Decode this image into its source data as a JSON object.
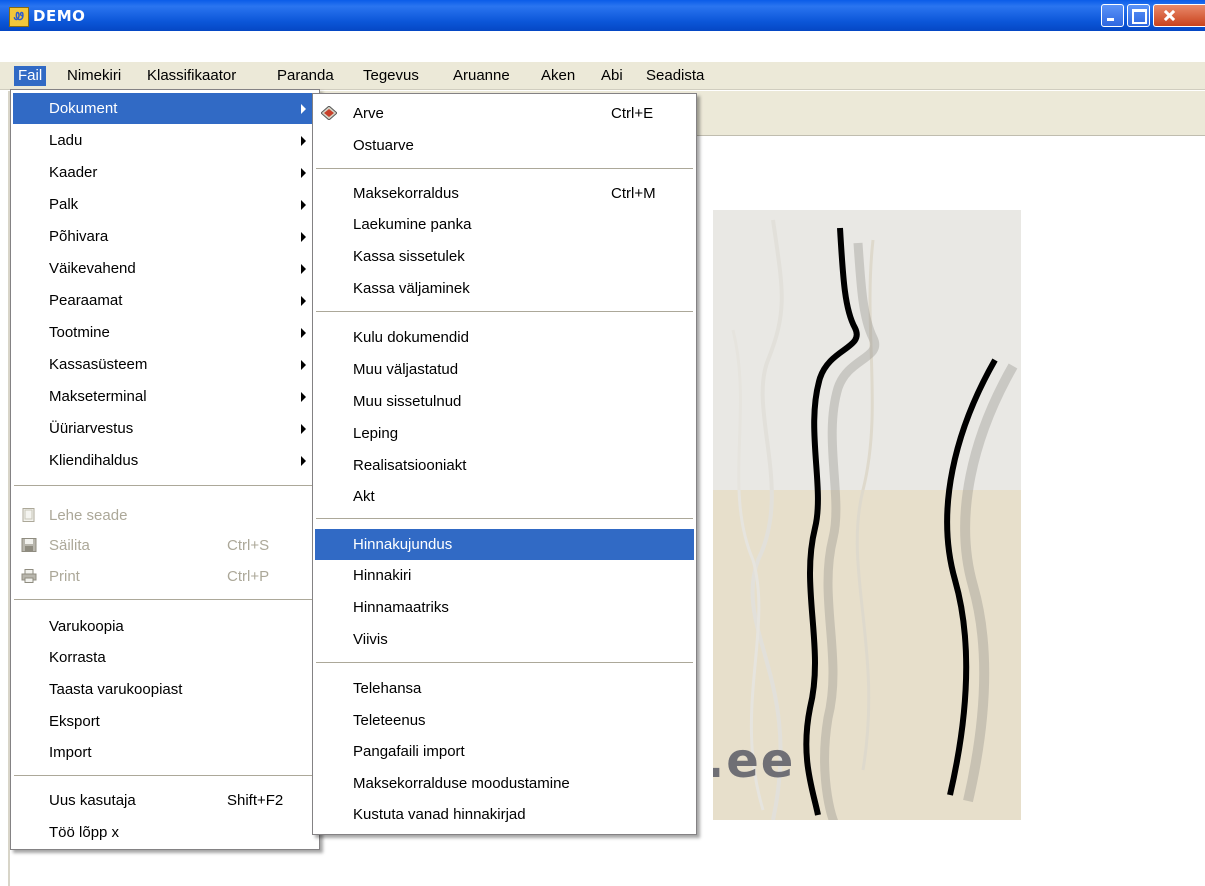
{
  "window": {
    "title": "DEMO",
    "app_icon_glyph": "Ꮺ"
  },
  "menubar": [
    "Fail",
    "Nimekiri",
    "Klassifikaator",
    "Paranda",
    "Tegevus",
    "Aruanne",
    "Aken",
    "Abi",
    "Seadista"
  ],
  "splash_text": ".ee",
  "fail_menu": [
    {
      "label": "Dokument"
    },
    {
      "label": "Ladu"
    },
    {
      "label": "Kaader"
    },
    {
      "label": "Palk"
    },
    {
      "label": "Põhivara"
    },
    {
      "label": "Väikevahend"
    },
    {
      "label": "Pearaamat"
    },
    {
      "label": "Tootmine"
    },
    {
      "label": "Kassasüsteem"
    },
    {
      "label": "Makseterminal"
    },
    {
      "label": "Üüriarvestus"
    },
    {
      "label": "Kliendihaldus"
    },
    {
      "label": "Lehe seade"
    },
    {
      "label": "Säilita",
      "shortcut": "Ctrl+S"
    },
    {
      "label": "Print",
      "shortcut": "Ctrl+P"
    },
    {
      "label": "Varukoopia"
    },
    {
      "label": "Korrasta"
    },
    {
      "label": "Taasta varukoopiast"
    },
    {
      "label": "Eksport"
    },
    {
      "label": "Import"
    },
    {
      "label": "Uus kasutaja",
      "shortcut": "Shift+F2"
    },
    {
      "label": "Töö lõpp x"
    }
  ],
  "doc_menu": [
    {
      "label": "Arve",
      "shortcut": "Ctrl+E"
    },
    {
      "label": "Ostuarve"
    },
    {
      "label": "Maksekorraldus",
      "shortcut": "Ctrl+M"
    },
    {
      "label": "Laekumine panka"
    },
    {
      "label": "Kassa sissetulek"
    },
    {
      "label": "Kassa väljaminek"
    },
    {
      "label": "Kulu dokumendid"
    },
    {
      "label": "Muu väljastatud"
    },
    {
      "label": "Muu sissetulnud"
    },
    {
      "label": "Leping"
    },
    {
      "label": "Realisatsiooniakt"
    },
    {
      "label": "Akt"
    },
    {
      "label": "Hinnakujundus"
    },
    {
      "label": "Hinnakiri"
    },
    {
      "label": "Hinnamaatriks"
    },
    {
      "label": "Viivis"
    },
    {
      "label": "Telehansa"
    },
    {
      "label": "Teleteenus"
    },
    {
      "label": "Pangafaili import"
    },
    {
      "label": "Maksekorralduse moodustamine"
    },
    {
      "label": "Kustuta vanad hinnakirjad"
    }
  ]
}
